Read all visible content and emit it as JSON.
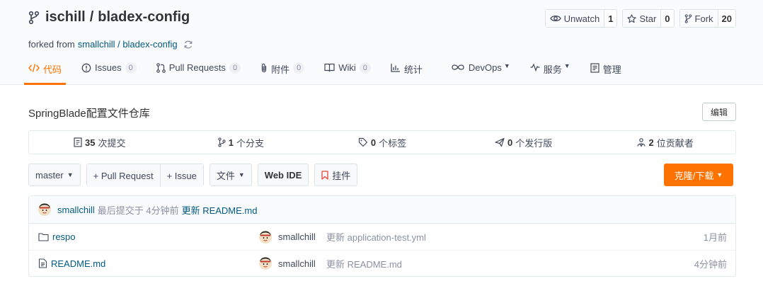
{
  "repo": {
    "owner": "ischill",
    "separator": "/",
    "name": "bladex-config",
    "forked_prefix": "forked from",
    "forked_source": "smallchill / bladex-config"
  },
  "actions": {
    "watch_label": "Unwatch",
    "watch_count": "1",
    "star_label": "Star",
    "star_count": "0",
    "fork_label": "Fork",
    "fork_count": "20"
  },
  "tabs": [
    {
      "label": "代码",
      "icon": "code-icon"
    },
    {
      "label": "Issues",
      "badge": "0",
      "icon": "issue-icon"
    },
    {
      "label": "Pull Requests",
      "badge": "0",
      "icon": "pull-request-icon"
    },
    {
      "label": "附件",
      "badge": "0",
      "icon": "attachment-icon"
    },
    {
      "label": "Wiki",
      "badge": "0",
      "icon": "wiki-icon"
    },
    {
      "label": "统计",
      "icon": "stats-icon"
    },
    {
      "label": "DevOps",
      "icon": "devops-icon"
    },
    {
      "label": "服务",
      "icon": "service-icon"
    },
    {
      "label": "管理",
      "icon": "manage-icon"
    }
  ],
  "description": {
    "text": "SpringBlade配置文件仓库",
    "edit_label": "编辑"
  },
  "stats": {
    "commits_count": "35",
    "commits_label": "次提交",
    "branches_count": "1",
    "branches_label": "个分支",
    "tags_count": "0",
    "tags_label": "个标签",
    "releases_count": "0",
    "releases_label": "个发行版",
    "contributors_count": "2",
    "contributors_label": "位贡献者"
  },
  "toolbar": {
    "branch": "master",
    "pull_request": "+ Pull Request",
    "issue": "+ Issue",
    "file": "文件",
    "web_ide": "Web IDE",
    "widget": "挂件",
    "clone": "克隆/下载"
  },
  "last_commit": {
    "author": "smallchill",
    "time_text": "最后提交于 4分钟前",
    "message": "更新 README.md"
  },
  "files": [
    {
      "name": "respo",
      "type": "folder",
      "author": "smallchill",
      "message": "更新 application-test.yml",
      "time": "1月前"
    },
    {
      "name": "README.md",
      "type": "file",
      "author": "smallchill",
      "message": "更新 README.md",
      "time": "4分钟前"
    }
  ],
  "colors": {
    "accent": "#fe7300",
    "link": "#005980",
    "header_bg": "#fafbfc"
  }
}
